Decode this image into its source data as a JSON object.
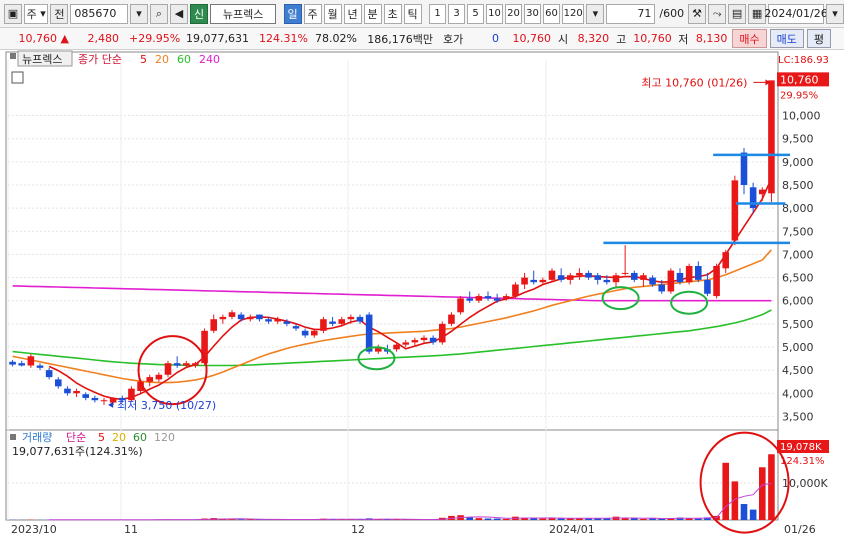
{
  "toolbar": {
    "market": "주",
    "prev": "전",
    "code": "085670",
    "tag": "신",
    "name": "뉴프렉스",
    "periods": [
      "일",
      "주",
      "월",
      "년",
      "분",
      "초",
      "틱"
    ],
    "period_selected": "일",
    "intervals": [
      "1",
      "3",
      "5",
      "10",
      "20",
      "30",
      "60",
      "120"
    ],
    "count": "71",
    "count_total": "/600",
    "date": "2024/01/26"
  },
  "quote": {
    "price": "10,760",
    "change": "2,480",
    "change_pct": "+29.95%",
    "volume": "19,077,631",
    "vol_ratio": "124.31%",
    "turnover": "78.02%",
    "amount": "186,176백만",
    "hoga_label": "호가",
    "hoga_value": "0",
    "hoga_price": "10,760",
    "open_label": "시",
    "open": "8,320",
    "high_label": "고",
    "high": "10,760",
    "low_label": "저",
    "low": "8,130",
    "buy": "매수",
    "sell": "매도",
    "more": "평"
  },
  "chart_data": {
    "type": "candlestick",
    "name": "뉴프렉스",
    "legend_prefix": "종가 단순",
    "ma_periods": [
      5,
      20,
      60,
      240
    ],
    "ma_colors": [
      "#e01010",
      "#f08020",
      "#28c028",
      "#e020d0"
    ],
    "up_color": "#e81818",
    "down_color": "#1c4fd8",
    "ylim": [
      3250,
      11200
    ],
    "yticks": [
      3500,
      4000,
      4500,
      5000,
      5500,
      6000,
      6500,
      7000,
      7500,
      8000,
      8500,
      9000,
      9500,
      10000
    ],
    "right_labels": {
      "lc": "LC:186.93",
      "price": "10,760",
      "pct": "29.95%"
    },
    "annotations": {
      "high": "최고 10,760 (01/26)",
      "low": "최저 3,750 (10/27)"
    },
    "x_labels": [
      "2023/10",
      "11",
      "12",
      "2024/01"
    ],
    "x_label_end": "01/26",
    "candles": [
      [
        4680,
        4720,
        4580,
        4620
      ],
      [
        4650,
        4700,
        4580,
        4600
      ],
      [
        4600,
        4850,
        4550,
        4800
      ],
      [
        4600,
        4650,
        4500,
        4550
      ],
      [
        4500,
        4550,
        4300,
        4350
      ],
      [
        4300,
        4350,
        4100,
        4150
      ],
      [
        4100,
        4150,
        3950,
        4000
      ],
      [
        4000,
        4100,
        3920,
        4050
      ],
      [
        3980,
        4020,
        3850,
        3900
      ],
      [
        3900,
        3950,
        3800,
        3850
      ],
      [
        3850,
        3900,
        3750,
        3850
      ],
      [
        3800,
        3920,
        3750,
        3900
      ],
      [
        3900,
        3950,
        3800,
        3850
      ],
      [
        3850,
        4150,
        3820,
        4100
      ],
      [
        4050,
        4300,
        4000,
        4250
      ],
      [
        4250,
        4400,
        4150,
        4350
      ],
      [
        4300,
        4450,
        4250,
        4400
      ],
      [
        4400,
        4700,
        4350,
        4650
      ],
      [
        4650,
        4800,
        4550,
        4600
      ],
      [
        4600,
        4700,
        4550,
        4650
      ],
      [
        4600,
        4680,
        4550,
        4650
      ],
      [
        4650,
        5400,
        4600,
        5350
      ],
      [
        5350,
        5700,
        5300,
        5600
      ],
      [
        5600,
        5700,
        5500,
        5650
      ],
      [
        5650,
        5800,
        5600,
        5750
      ],
      [
        5700,
        5750,
        5550,
        5600
      ],
      [
        5600,
        5700,
        5550,
        5650
      ],
      [
        5700,
        5700,
        5550,
        5600
      ],
      [
        5600,
        5650,
        5500,
        5550
      ],
      [
        5550,
        5650,
        5500,
        5600
      ],
      [
        5550,
        5600,
        5450,
        5500
      ],
      [
        5450,
        5500,
        5350,
        5400
      ],
      [
        5350,
        5400,
        5200,
        5250
      ],
      [
        5250,
        5400,
        5200,
        5350
      ],
      [
        5350,
        5650,
        5300,
        5600
      ],
      [
        5550,
        5650,
        5450,
        5500
      ],
      [
        5500,
        5650,
        5450,
        5600
      ],
      [
        5600,
        5700,
        5500,
        5650
      ],
      [
        5650,
        5700,
        5500,
        5550
      ],
      [
        5700,
        5750,
        4850,
        4900
      ],
      [
        4900,
        5050,
        4850,
        5000
      ],
      [
        4950,
        5050,
        4850,
        4900
      ],
      [
        4950,
        5100,
        4900,
        5050
      ],
      [
        5050,
        5150,
        5000,
        5100
      ],
      [
        5100,
        5200,
        5000,
        5150
      ],
      [
        5150,
        5250,
        5100,
        5200
      ],
      [
        5200,
        5250,
        5050,
        5100
      ],
      [
        5100,
        5550,
        5050,
        5500
      ],
      [
        5500,
        5750,
        5450,
        5700
      ],
      [
        5750,
        6100,
        5700,
        6050
      ],
      [
        6050,
        6200,
        5950,
        6000
      ],
      [
        6000,
        6150,
        5950,
        6100
      ],
      [
        6100,
        6200,
        6000,
        6050
      ],
      [
        6050,
        6150,
        5950,
        6000
      ],
      [
        6050,
        6150,
        6000,
        6100
      ],
      [
        6100,
        6400,
        6050,
        6350
      ],
      [
        6350,
        6600,
        6250,
        6500
      ],
      [
        6450,
        6650,
        6350,
        6400
      ],
      [
        6400,
        6500,
        6350,
        6450
      ],
      [
        6450,
        6700,
        6400,
        6650
      ],
      [
        6550,
        6700,
        6400,
        6450
      ],
      [
        6450,
        6600,
        6350,
        6550
      ],
      [
        6550,
        6700,
        6450,
        6600
      ],
      [
        6600,
        6650,
        6450,
        6500
      ],
      [
        6550,
        6600,
        6350,
        6450
      ],
      [
        6450,
        6550,
        6350,
        6400
      ],
      [
        6400,
        6600,
        6300,
        6550
      ],
      [
        6600,
        7200,
        6550,
        6600
      ],
      [
        6600,
        6650,
        6400,
        6450
      ],
      [
        6450,
        6600,
        6300,
        6550
      ],
      [
        6500,
        6550,
        6300,
        6350
      ],
      [
        6350,
        6450,
        6150,
        6200
      ],
      [
        6200,
        6700,
        6150,
        6650
      ],
      [
        6600,
        6700,
        6350,
        6400
      ],
      [
        6400,
        6800,
        6350,
        6750
      ],
      [
        6750,
        6850,
        6400,
        6450
      ],
      [
        6450,
        6600,
        6100,
        6150
      ],
      [
        6100,
        6800,
        6050,
        6750
      ],
      [
        6700,
        7100,
        6600,
        7050
      ],
      [
        7300,
        8700,
        7200,
        8600
      ],
      [
        9200,
        9300,
        8300,
        8500
      ],
      [
        8450,
        8550,
        7900,
        8000
      ],
      [
        8300,
        8450,
        8150,
        8400
      ],
      [
        8320,
        10760,
        8130,
        10760
      ]
    ],
    "ma5": [
      null,
      null,
      null,
      null,
      4580,
      4490,
      4370,
      4220,
      4110,
      4020,
      3940,
      3890,
      3870,
      3910,
      3990,
      4090,
      4180,
      4300,
      4450,
      4560,
      4620,
      4790,
      5020,
      5240,
      5430,
      5580,
      5640,
      5650,
      5640,
      5600,
      5560,
      5500,
      5430,
      5380,
      5380,
      5410,
      5460,
      5540,
      5580,
      5430,
      5330,
      5210,
      5090,
      4960,
      5020,
      5080,
      5110,
      5210,
      5340,
      5490,
      5640,
      5770,
      5880,
      5990,
      6040,
      6090,
      6180,
      6250,
      6350,
      6410,
      6470,
      6510,
      6530,
      6540,
      6520,
      6510,
      6500,
      6520,
      6520,
      6480,
      6430,
      6400,
      6410,
      6450,
      6500,
      6520,
      6560,
      6700,
      7000,
      7300,
      7600,
      7900,
      8200,
      8640
    ],
    "ma20": [
      4800,
      4760,
      4720,
      4680,
      4640,
      4600,
      4560,
      4520,
      4480,
      4440,
      4400,
      4360,
      4320,
      4290,
      4260,
      4240,
      4230,
      4230,
      4240,
      4260,
      4290,
      4330,
      4390,
      4460,
      4540,
      4620,
      4700,
      4780,
      4850,
      4910,
      4970,
      5020,
      5060,
      5100,
      5140,
      5170,
      5200,
      5230,
      5260,
      5280,
      5290,
      5300,
      5310,
      5320,
      5330,
      5340,
      5360,
      5380,
      5400,
      5430,
      5470,
      5510,
      5550,
      5590,
      5630,
      5680,
      5730,
      5780,
      5840,
      5900,
      5950,
      6000,
      6050,
      6100,
      6140,
      6180,
      6220,
      6260,
      6290,
      6310,
      6330,
      6350,
      6370,
      6390,
      6410,
      6430,
      6450,
      6500,
      6560,
      6640,
      6720,
      6800,
      6880,
      7100
    ],
    "ma60": [
      4900,
      4880,
      4860,
      4840,
      4820,
      4800,
      4780,
      4760,
      4740,
      4720,
      4700,
      4680,
      4665,
      4650,
      4640,
      4630,
      4620,
      4615,
      4610,
      4605,
      4600,
      4600,
      4600,
      4600,
      4600,
      4605,
      4610,
      4620,
      4630,
      4640,
      4650,
      4660,
      4670,
      4680,
      4690,
      4700,
      4710,
      4720,
      4730,
      4740,
      4750,
      4760,
      4770,
      4780,
      4790,
      4800,
      4810,
      4820,
      4835,
      4850,
      4870,
      4890,
      4910,
      4930,
      4950,
      4970,
      4990,
      5010,
      5030,
      5050,
      5070,
      5090,
      5110,
      5130,
      5150,
      5170,
      5190,
      5210,
      5230,
      5250,
      5270,
      5290,
      5310,
      5330,
      5350,
      5380,
      5410,
      5440,
      5480,
      5520,
      5570,
      5630,
      5700,
      5800
    ],
    "ma240": [
      6320,
      6315,
      6310,
      6305,
      6300,
      6295,
      6290,
      6285,
      6280,
      6275,
      6270,
      6265,
      6260,
      6255,
      6250,
      6245,
      6240,
      6235,
      6230,
      6225,
      6220,
      6215,
      6210,
      6205,
      6200,
      6195,
      6190,
      6185,
      6180,
      6175,
      6170,
      6165,
      6160,
      6155,
      6150,
      6145,
      6140,
      6135,
      6130,
      6125,
      6120,
      6115,
      6110,
      6105,
      6100,
      6095,
      6090,
      6085,
      6080,
      6075,
      6070,
      6065,
      6060,
      6055,
      6050,
      6045,
      6040,
      6035,
      6030,
      6025,
      6020,
      6015,
      6010,
      6005,
      6000,
      6000,
      6000,
      6000,
      6000,
      6000,
      6000,
      6000,
      6000,
      6000,
      6000,
      6000,
      6000,
      6000,
      6000,
      6000,
      6000,
      6000,
      6000,
      6000
    ],
    "volume": {
      "label": "거래량",
      "legend_prefix": "단순",
      "ma_periods": [
        5,
        20,
        60,
        120
      ],
      "ma_colors": [
        "#e01010",
        "#d8b000",
        "#2c8c2c",
        "#999999"
      ],
      "current_text": "19,077,631주(124.31%)",
      "right_labels": {
        "value": "19,078K",
        "pct": "124.31%"
      },
      "ytick": {
        "value": 10000000,
        "label": "10,000K"
      },
      "ylim": [
        0,
        21000000
      ],
      "values": [
        60000,
        50000,
        80000,
        40000,
        60000,
        70000,
        50000,
        40000,
        60000,
        50000,
        80000,
        40000,
        60000,
        120000,
        100000,
        130000,
        90000,
        160000,
        110000,
        80000,
        70000,
        400000,
        520000,
        260000,
        220000,
        180000,
        160000,
        150000,
        140000,
        120000,
        150000,
        140000,
        130000,
        180000,
        350000,
        160000,
        140000,
        150000,
        170000,
        450000,
        220000,
        180000,
        140000,
        150000,
        130000,
        140000,
        160000,
        600000,
        1100000,
        1300000,
        700000,
        500000,
        400000,
        380000,
        300000,
        900000,
        650000,
        420000,
        380000,
        420000,
        600000,
        500000,
        450000,
        400000,
        480000,
        420000,
        900000,
        450000,
        400000,
        300000,
        450000,
        380000,
        500000,
        650000,
        480000,
        380000,
        700000,
        1100000,
        15400000,
        10400000,
        4300000,
        2800000,
        14200000,
        17700000
      ]
    },
    "marks": {
      "red_circles": [
        {
          "i": 17.5,
          "v": 4500,
          "r": 34
        },
        {
          "i": 80.5,
          "v": 9000000,
          "r": 44
        }
      ],
      "green_ellipses": [
        {
          "i": 39.8,
          "v": 4800
        },
        {
          "i": 66.5,
          "v": 6100
        },
        {
          "i": 74,
          "v": 6000
        }
      ],
      "blue_lines": [
        {
          "v": 9150,
          "i0": 77.5,
          "i1": 83.5
        },
        {
          "v": 8100,
          "i0": 80,
          "i1": 83
        },
        {
          "v": 7250,
          "i0": 65.5,
          "i1": 83.5
        }
      ]
    }
  }
}
